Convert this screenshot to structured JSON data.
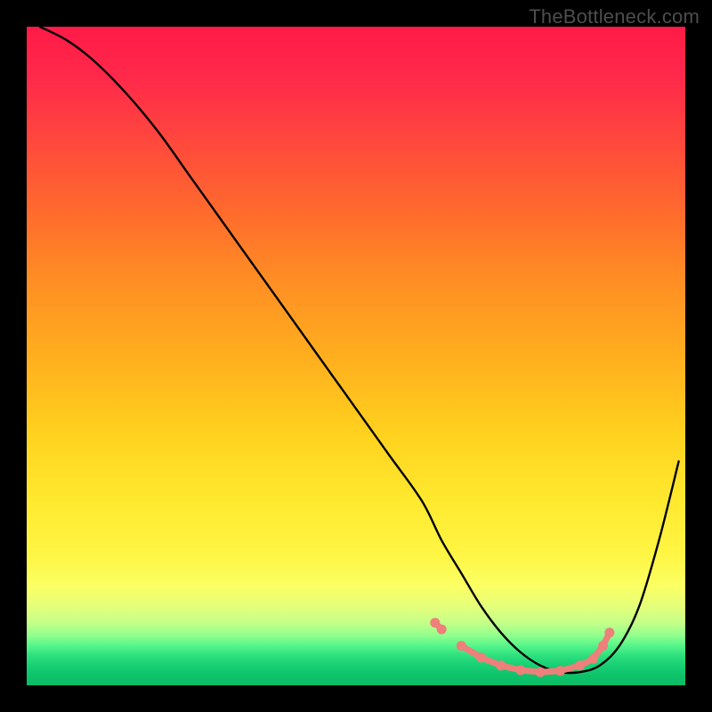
{
  "watermark": "TheBottleneck.com",
  "chart_data": {
    "type": "line",
    "title": "",
    "xlabel": "",
    "ylabel": "",
    "xlim": [
      0,
      100
    ],
    "ylim": [
      0,
      100
    ],
    "series": [
      {
        "name": "bottleneck-curve",
        "x": [
          2,
          6,
          10,
          15,
          20,
          25,
          30,
          35,
          40,
          45,
          50,
          55,
          60,
          63,
          66,
          69,
          72,
          75,
          78,
          81,
          84,
          87,
          90,
          93,
          96,
          99
        ],
        "y": [
          100,
          98,
          95,
          90,
          84,
          77,
          70,
          63,
          56,
          49,
          42,
          35,
          28,
          22,
          17,
          12,
          8,
          5,
          3,
          2,
          2,
          3,
          6,
          12,
          22,
          34
        ]
      }
    ],
    "markers": {
      "name": "highlighted-region",
      "points": [
        {
          "x": 62,
          "y": 9.5
        },
        {
          "x": 63,
          "y": 8.5
        },
        {
          "x": 66,
          "y": 6
        },
        {
          "x": 69,
          "y": 4.2
        },
        {
          "x": 72,
          "y": 3
        },
        {
          "x": 75,
          "y": 2.3
        },
        {
          "x": 78,
          "y": 2
        },
        {
          "x": 81,
          "y": 2.2
        },
        {
          "x": 84,
          "y": 3
        },
        {
          "x": 86,
          "y": 4
        },
        {
          "x": 87.5,
          "y": 6
        },
        {
          "x": 88.5,
          "y": 8
        }
      ]
    },
    "gradient_stops": [
      {
        "pos": 0,
        "color": "#ff1a47"
      },
      {
        "pos": 50,
        "color": "#ffae1e"
      },
      {
        "pos": 85,
        "color": "#fbff63"
      },
      {
        "pos": 95,
        "color": "#2de07e"
      },
      {
        "pos": 100,
        "color": "#0abb65"
      }
    ]
  }
}
